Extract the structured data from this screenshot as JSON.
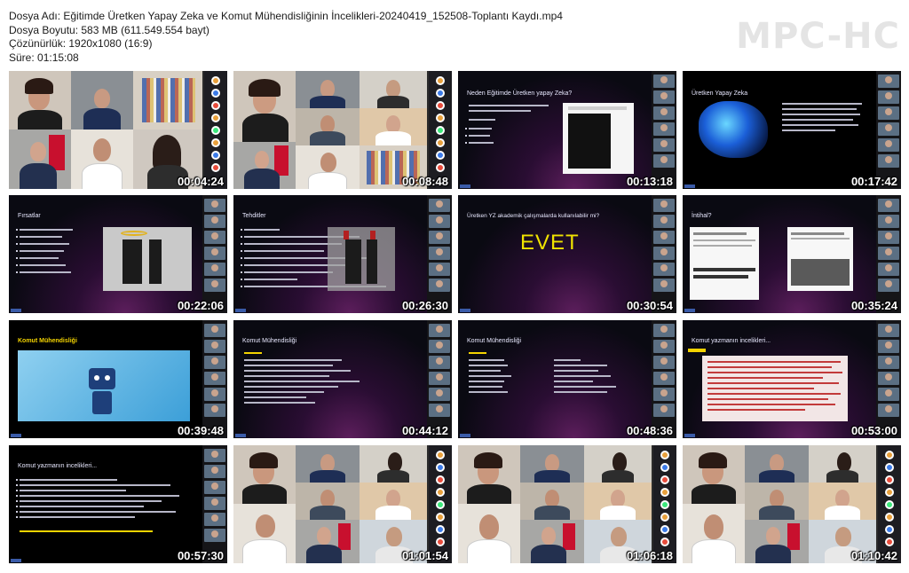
{
  "file_info": {
    "name": "Dosya Adı: Eğitimde Üretken Yapay Zeka ve Komut Mühendisliğinin İncelikleri-20240419_152508-Toplantı Kaydı.mp4",
    "size": "Dosya Boyutu: 583 MB (611.549.554 bayt)",
    "resolution": "Çözünürlük: 1920x1080 (16:9)",
    "duration": "Süre: 01:15:08"
  },
  "logo": "MPC-HC",
  "thumbnails": [
    {
      "time": "00:04:24",
      "kind": "video"
    },
    {
      "time": "00:08:48",
      "kind": "video"
    },
    {
      "time": "00:13:18",
      "kind": "slide",
      "title": "Neden Eğitimde Üretken yapay Zeka?"
    },
    {
      "time": "00:17:42",
      "kind": "slide",
      "title": "Üretken Yapay Zeka"
    },
    {
      "time": "00:22:06",
      "kind": "slide",
      "title": "Fırsatlar"
    },
    {
      "time": "00:26:30",
      "kind": "slide",
      "title": "Tehditler"
    },
    {
      "time": "00:30:54",
      "kind": "slide",
      "title": "Üretken YZ akademik çalışmalarda kullanılabilir mi?",
      "big": "EVET"
    },
    {
      "time": "00:35:24",
      "kind": "slide",
      "title": "İntihal?"
    },
    {
      "time": "00:39:48",
      "kind": "slide",
      "title": "Komut Mühendisliği"
    },
    {
      "time": "00:44:12",
      "kind": "slide",
      "title": "Komut Mühendisliği"
    },
    {
      "time": "00:48:36",
      "kind": "slide",
      "title": "Komut Mühendisliği"
    },
    {
      "time": "00:53:00",
      "kind": "slide",
      "title": "Komut yazmanın incelikleri..."
    },
    {
      "time": "00:57:30",
      "kind": "slide",
      "title": "Komut yazmanın incelikleri..."
    },
    {
      "time": "01:01:54",
      "kind": "video"
    },
    {
      "time": "01:06:18",
      "kind": "video"
    },
    {
      "time": "01:10:42",
      "kind": "video"
    }
  ]
}
